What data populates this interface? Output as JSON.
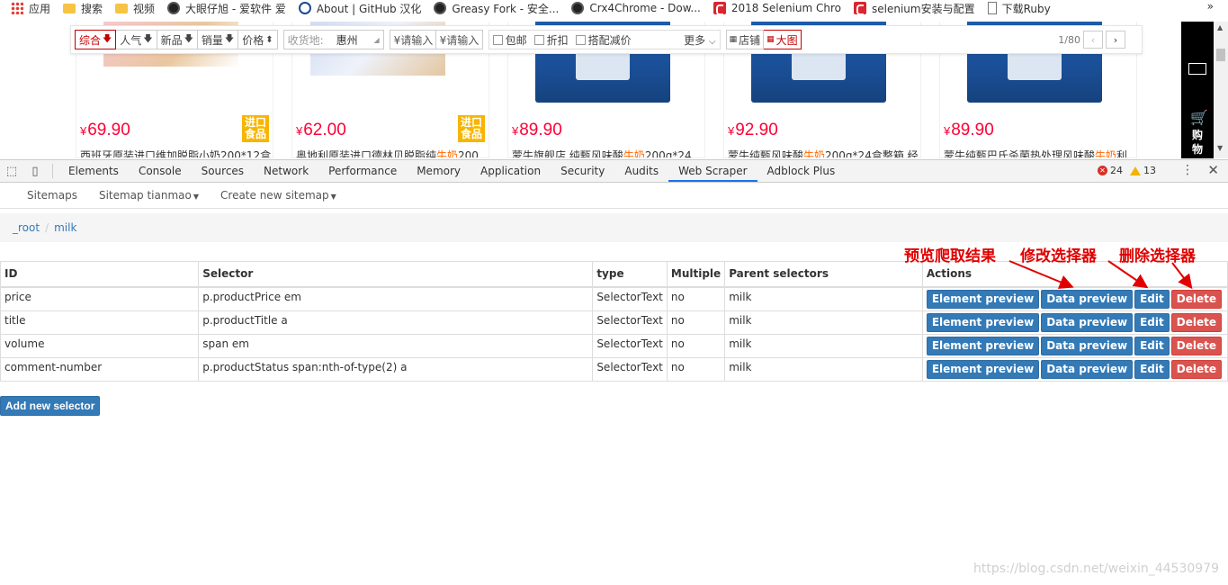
{
  "bookmarks": {
    "items": [
      {
        "label": "应用",
        "icon": "apps-grid-icon"
      },
      {
        "label": "搜索",
        "icon": "folder-icon"
      },
      {
        "label": "视频",
        "icon": "folder-icon"
      },
      {
        "label": "大眼仔旭 - 爱软件 爱",
        "icon": "site-circle-icon"
      },
      {
        "label": "About | GitHub 汉化",
        "icon": "github-icon"
      },
      {
        "label": "Greasy Fork - 安全...",
        "icon": "greasyfork-icon"
      },
      {
        "label": "Crx4Chrome - Dow...",
        "icon": "crx4chrome-icon"
      },
      {
        "label": "2018 Selenium Chro",
        "icon": "csdn-icon"
      },
      {
        "label": "selenium安装与配置",
        "icon": "csdn-icon"
      },
      {
        "label": "下载Ruby",
        "icon": "document-icon"
      }
    ],
    "more": "»"
  },
  "filterbar": {
    "sort": [
      {
        "label": "综合",
        "arrow": "🡇"
      },
      {
        "label": "人气",
        "arrow": "🡇"
      },
      {
        "label": "新品",
        "arrow": "🡇"
      },
      {
        "label": "销量",
        "arrow": "🡇"
      },
      {
        "label": "价格",
        "arrow": "⬍"
      }
    ],
    "ship_label": "收货地:",
    "ship_value": "惠州",
    "price_min_placeholder": "¥请输入",
    "price_max_placeholder": "¥请输入",
    "checks": [
      "包邮",
      "折扣",
      "搭配减价"
    ],
    "more": "更多",
    "view_shop": "店铺",
    "view_big": "大图",
    "page": "1/80"
  },
  "products": [
    {
      "price": "69.90",
      "badge": "进口食品",
      "title_a": "西班牙原装进口维加脱脂小奶200*12盒",
      "title_hl": "",
      "title_b": ""
    },
    {
      "price": "62.00",
      "badge": "进口食品",
      "title_a": "奥地利原装进口德林贝脱脂纯",
      "title_hl": "牛奶",
      "title_b": "200"
    },
    {
      "price": "89.90",
      "badge": "",
      "title_a": "蒙牛旗舰店 纯甄风味酸",
      "title_hl": "牛奶",
      "title_b": "200g*24"
    },
    {
      "price": "92.90",
      "badge": "",
      "title_a": "蒙牛纯甄风味酸",
      "title_hl": "牛奶",
      "title_b": "200g*24盒整箱 经"
    },
    {
      "price": "89.90",
      "badge": "",
      "title_a": "蒙牛纯甄巴氏杀菌热处理风味酸",
      "title_hl": "牛奶",
      "title_b": "利"
    }
  ],
  "cartbar": {
    "label": "购物"
  },
  "devtools": {
    "tabs": [
      "Elements",
      "Console",
      "Sources",
      "Network",
      "Performance",
      "Memory",
      "Application",
      "Security",
      "Audits",
      "Web Scraper",
      "Adblock Plus"
    ],
    "active_tab": "Web Scraper",
    "errors": "24",
    "warnings": "13"
  },
  "webscraper": {
    "nav": {
      "sitemaps": "Sitemaps",
      "sitemap": "Sitemap tianmao",
      "create": "Create new sitemap"
    },
    "breadcrumb": {
      "root": "_root",
      "sep": "/",
      "current": "milk"
    },
    "table": {
      "headers": [
        "ID",
        "Selector",
        "type",
        "Multiple",
        "Parent selectors",
        "Actions"
      ],
      "rows": [
        {
          "id": "price",
          "selector": "p.productPrice em",
          "type": "SelectorText",
          "multiple": "no",
          "parent": "milk"
        },
        {
          "id": "title",
          "selector": "p.productTitle a",
          "type": "SelectorText",
          "multiple": "no",
          "parent": "milk"
        },
        {
          "id": "volume",
          "selector": "span em",
          "type": "SelectorText",
          "multiple": "no",
          "parent": "milk"
        },
        {
          "id": "comment-number",
          "selector": "p.productStatus span:nth-of-type(2) a",
          "type": "SelectorText",
          "multiple": "no",
          "parent": "milk"
        }
      ],
      "actions": {
        "element_preview": "Element preview",
        "data_preview": "Data preview",
        "edit": "Edit",
        "delete": "Delete"
      }
    },
    "add_selector": "Add new selector"
  },
  "annotations": {
    "preview": "预览爬取结果",
    "modify": "修改选择器",
    "delete": "删除选择器"
  },
  "watermark": "https://blog.csdn.net/weixin_44530979",
  "colors": {
    "accent": "#337ab7",
    "danger": "#d9534f",
    "price": "#ff0036",
    "annotation": "#e00000"
  }
}
